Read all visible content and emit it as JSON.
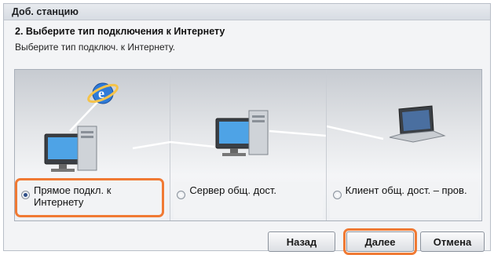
{
  "window": {
    "title": "Доб. станцию"
  },
  "step": {
    "title": "2. Выберите тип подключения к Интернету",
    "subtitle": "Выберите тип подключ. к Интернету."
  },
  "options": [
    {
      "label": "Прямое подкл. к Интернету",
      "checked": true,
      "icon": "internet-computer-icon"
    },
    {
      "label": "Сервер общ. дост.",
      "checked": false,
      "icon": "server-computer-icon"
    },
    {
      "label": "Клиент общ. дост. – пров.",
      "checked": false,
      "icon": "laptop-icon"
    }
  ],
  "buttons": {
    "back": "Назад",
    "next": "Далее",
    "cancel": "Отмена"
  },
  "colors": {
    "highlight": "#f07a34",
    "selected_dot": "#2f4f88"
  }
}
